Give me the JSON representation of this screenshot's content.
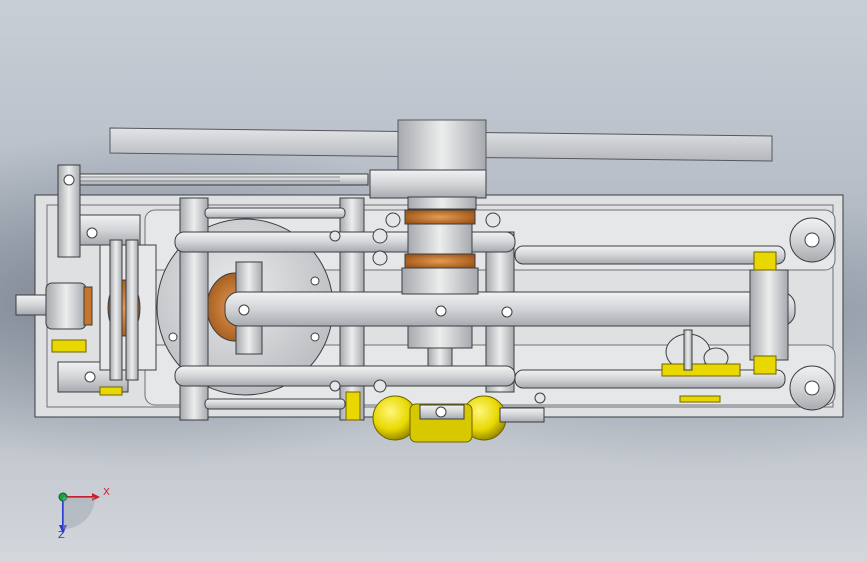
{
  "scene": {
    "description_visible": false,
    "background_top": "#c9ced6",
    "background_bottom": "#d4d7dc"
  },
  "colors": {
    "steel": "#d5d7da",
    "steel_dark": "#8d9096",
    "outline": "#3b3d40",
    "bronze": "#c8742a",
    "yellow": "#e8d800",
    "frame": "#e2e3e4"
  },
  "triad": {
    "x_label": "X",
    "z_label": "Z",
    "x_color": "#c8202a",
    "z_color": "#2a3bd0",
    "origin_color": "#1ca04a"
  },
  "icons": {
    "triad": "coordinate-triad-icon"
  }
}
